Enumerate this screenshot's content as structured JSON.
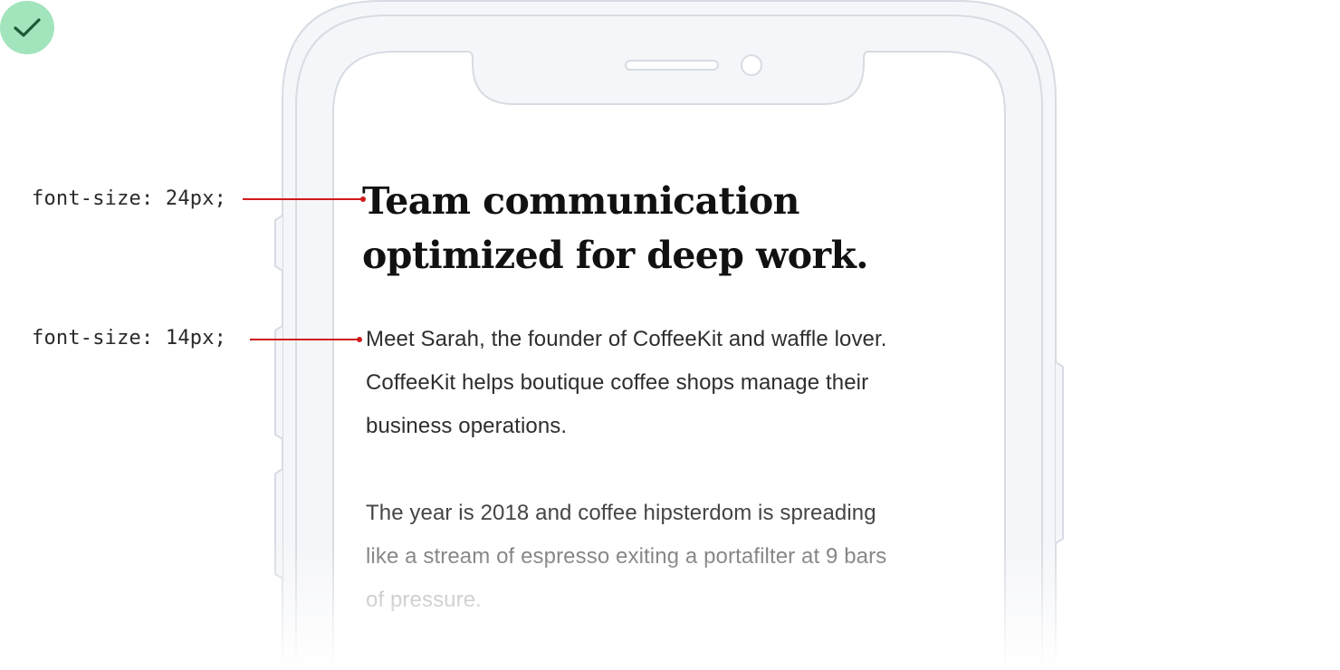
{
  "badge": {
    "icon": "checkmark-icon",
    "color": "#a2e4bc",
    "stroke": "#1d5a35"
  },
  "annotations": {
    "heading": "font-size: 24px;",
    "body": "font-size: 14px;"
  },
  "content": {
    "headline_lines": [
      "Team communication",
      "optimized for deep work."
    ],
    "paragraph_1_lines": [
      "Meet Sarah, the founder of CoffeeKit and waffle lover.",
      "CoffeeKit helps boutique coffee shops manage their",
      "business operations."
    ],
    "paragraph_2_lines": [
      "The year is 2018 and coffee hipsterdom is spreading",
      "like a stream of espresso exiting a portafilter at 9 bars",
      "of pressure."
    ]
  },
  "colors": {
    "leader_line": "#d0191b",
    "phone_outline": "#d7dbe3",
    "phone_fill": "#f5f6f9"
  }
}
